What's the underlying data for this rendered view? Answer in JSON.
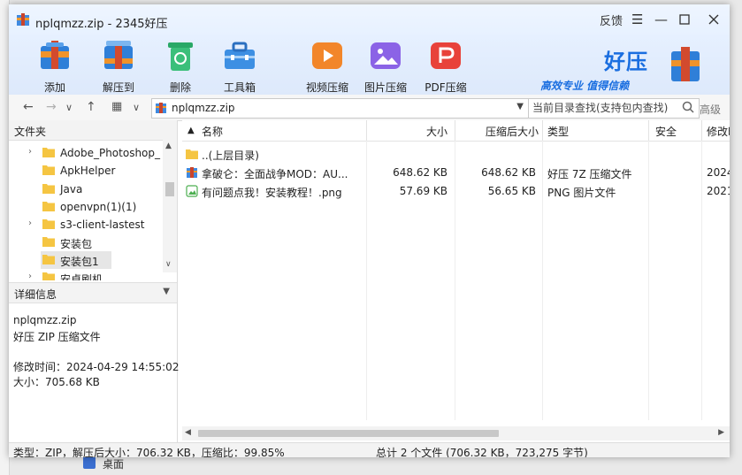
{
  "window": {
    "title": "nplqmzz.zip - 2345好压",
    "feedback": "反馈",
    "menu_icon": "hamburger-icon",
    "minimize_icon": "minimize-icon",
    "maximize_icon": "maximize-icon",
    "close_icon": "close-icon"
  },
  "toolbar": {
    "add": "添加",
    "extract": "解压到",
    "delete": "删除",
    "toolbox": "工具箱",
    "video": "视频压缩",
    "image": "图片压缩",
    "pdf": "PDF压缩"
  },
  "brand": {
    "name": "好压",
    "slogan": "高效专业  值得信赖"
  },
  "address": {
    "path": "nplqmzz.zip",
    "search_placeholder": "当前目录查找(支持包内查找)",
    "advanced": "高级"
  },
  "sidebar": {
    "header": "文件夹",
    "items": [
      {
        "label": "Adobe_Photoshop_",
        "chevron": "›"
      },
      {
        "label": "ApkHelper",
        "chevron": ""
      },
      {
        "label": "Java",
        "chevron": ""
      },
      {
        "label": "openvpn(1)(1)",
        "chevron": ""
      },
      {
        "label": "s3-client-lastest",
        "chevron": "›"
      },
      {
        "label": "安装包",
        "chevron": ""
      },
      {
        "label": "安装包1",
        "chevron": ""
      },
      {
        "label": "安卓刷机",
        "chevron": "›"
      }
    ]
  },
  "details": {
    "header": "详细信息",
    "filename": "nplqmzz.zip",
    "filetype": "好压 ZIP 压缩文件",
    "modified": "修改时间：2024-04-29 14:55:02",
    "size": "大小：705.68 KB"
  },
  "columns": {
    "name": "名称",
    "size": "大小",
    "packed": "压缩后大小",
    "type": "类型",
    "security": "安全",
    "modified": "修改时"
  },
  "files": [
    {
      "name": "..(上层目录)",
      "size": "",
      "packed": "",
      "type": "",
      "modified": "",
      "icon": "folder-icon"
    },
    {
      "name": "拿破仑：全面战争MOD：AU...",
      "size": "648.62 KB",
      "packed": "648.62 KB",
      "type": "好压 7Z 压缩文件",
      "modified": "2024-",
      "icon": "archive-7z-icon"
    },
    {
      "name": "有问题点我！安装教程！.png",
      "size": "57.69 KB",
      "packed": "56.65 KB",
      "type": "PNG 图片文件",
      "modified": "2021-",
      "icon": "png-image-icon"
    }
  ],
  "status": {
    "left": "类型：ZIP，解压后大小：706.32 KB，压缩比：99.85%",
    "right": "总计 2 个文件 (706.32 KB，723,275 字节)"
  },
  "background": {
    "taskbar_text": "桌面"
  }
}
